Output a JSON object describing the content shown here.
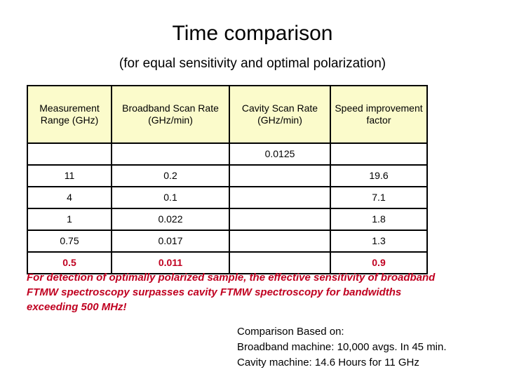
{
  "slide": {
    "title": "Time comparison",
    "subtitle": "(for equal sensitivity and optimal polarization)"
  },
  "table": {
    "headers": [
      "Measurement Range (GHz)",
      "Broadband Scan Rate (GHz/min)",
      "Cavity Scan Rate (GHz/min)",
      "Speed improvement factor"
    ],
    "rows": [
      {
        "range": "",
        "broadband": "",
        "cavity": "0.0125",
        "speedup": "",
        "highlight": false
      },
      {
        "range": "11",
        "broadband": "0.2",
        "cavity": "",
        "speedup": "19.6",
        "highlight": false
      },
      {
        "range": "4",
        "broadband": "0.1",
        "cavity": "",
        "speedup": "7.1",
        "highlight": false
      },
      {
        "range": "1",
        "broadband": "0.022",
        "cavity": "",
        "speedup": "1.8",
        "highlight": false
      },
      {
        "range": "0.75",
        "broadband": "0.017",
        "cavity": "",
        "speedup": "1.3",
        "highlight": false
      },
      {
        "range": "0.5",
        "broadband": "0.011",
        "cavity": "",
        "speedup": "0.9",
        "highlight": true
      }
    ]
  },
  "note_red": {
    "line1": "For detection of optimally polarized sample, the effective sensitivity of broadband",
    "line2": "FTMW spectroscopy surpasses cavity FTMW spectroscopy for bandwidths",
    "line3": "exceeding 500 MHz!"
  },
  "note_black": {
    "line1": "Comparison Based on:",
    "line2": "Broadband machine: 10,000 avgs. In 45 min.",
    "line3": "Cavity machine: 14.6 Hours for 11 GHz"
  },
  "colors": {
    "header_background": "#fbfbcb",
    "highlight_text": "#c00020",
    "body_text": "#000000"
  }
}
